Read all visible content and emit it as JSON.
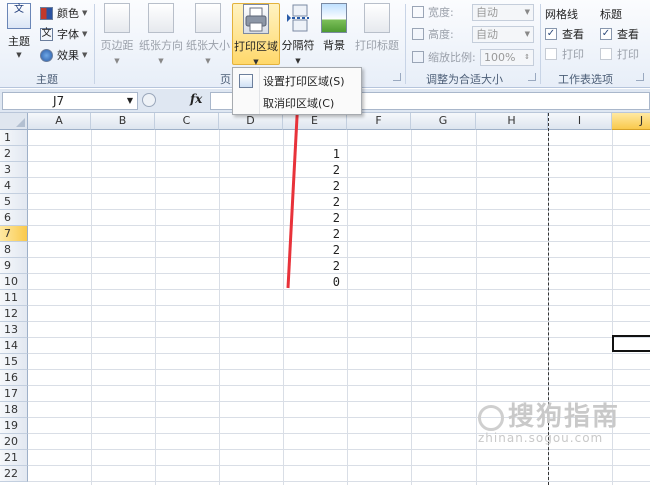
{
  "ribbon": {
    "theme_group": {
      "label": "主题",
      "theme_button": "主题",
      "theme_icon_text": "文",
      "colors": "颜色",
      "fonts": "字体",
      "fonts_icon_text": "文",
      "effects": "效果"
    },
    "page_setup_group": {
      "label": "页",
      "margins": "页边距",
      "orientation": "纸张方向",
      "size": "纸张大小",
      "print_area": "打印区域",
      "breaks": "分隔符",
      "background": "背景",
      "print_titles": "打印标题"
    },
    "scale_group": {
      "label": "调整为合适大小",
      "width_label": "宽度:",
      "width_value": "自动",
      "height_label": "高度:",
      "height_value": "自动",
      "scale_label": "缩放比例:",
      "scale_value": "100%"
    },
    "sheet_options_group": {
      "label": "工作表选项",
      "gridlines": {
        "title": "网格线",
        "view": "查看",
        "print": "打印",
        "view_checked": true,
        "print_checked": false
      },
      "headings": {
        "title": "标题",
        "view": "查看",
        "print": "打印",
        "view_checked": true,
        "print_checked": false
      }
    }
  },
  "menu": {
    "items": [
      {
        "label": "设置打印区域(S)"
      },
      {
        "label": "取消印区域(C)"
      }
    ]
  },
  "formula_bar": {
    "name_box": "J7",
    "fx": "fx",
    "formula": ""
  },
  "sheet": {
    "columns": [
      "A",
      "B",
      "C",
      "D",
      "E",
      "F",
      "G",
      "H",
      "I",
      "J"
    ],
    "selected_column": "J",
    "rows": [
      "1",
      "2",
      "3",
      "4",
      "5",
      "6",
      "7",
      "8",
      "9",
      "10",
      "11",
      "12",
      "13",
      "14",
      "15",
      "16",
      "17",
      "18",
      "19",
      "20",
      "21",
      "22"
    ],
    "selected_row": "7",
    "column_e_values": [
      "",
      "1",
      "2",
      "2",
      "2",
      "2",
      "2",
      "2",
      "2",
      "0"
    ]
  },
  "watermark": {
    "cn": "搜狗指南",
    "en": "zhinan.sogou.com"
  },
  "colors": {
    "accent": "#f9c94c",
    "arrow": "#e8323a",
    "ribbon": "#e7eef8"
  }
}
